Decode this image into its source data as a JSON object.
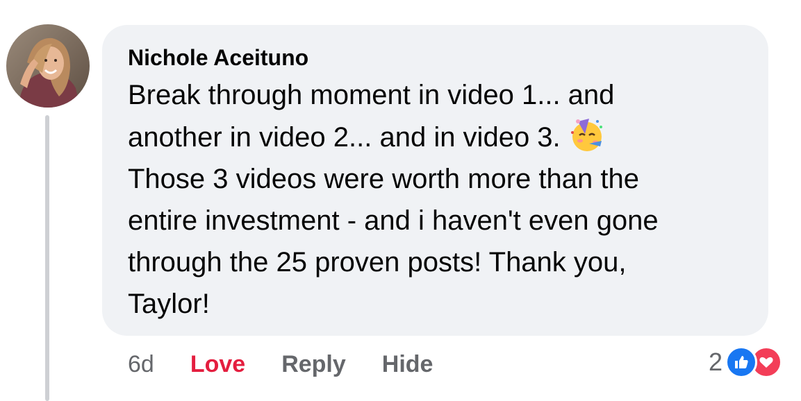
{
  "comment": {
    "author": "Nichole Aceituno",
    "lines": [
      "Break through moment in video 1... and",
      "another in video 2... and in video 3.",
      "Those 3 videos were worth more than the",
      "entire investment - and i haven't even gone",
      "through the 25 proven posts! Thank you,",
      "Taylor!"
    ],
    "emoji": "partying-face",
    "timestamp": "6d",
    "actions": {
      "love_label": "Love",
      "reply_label": "Reply",
      "hide_label": "Hide"
    },
    "reactions": {
      "count": "2",
      "types": [
        "like-icon",
        "love-icon"
      ]
    }
  },
  "colors": {
    "bubble": "#f0f2f5",
    "love_active": "#e41e3f",
    "meta_text": "#65676b",
    "like_blue": "#1877f2",
    "love_red": "#f33e58"
  }
}
